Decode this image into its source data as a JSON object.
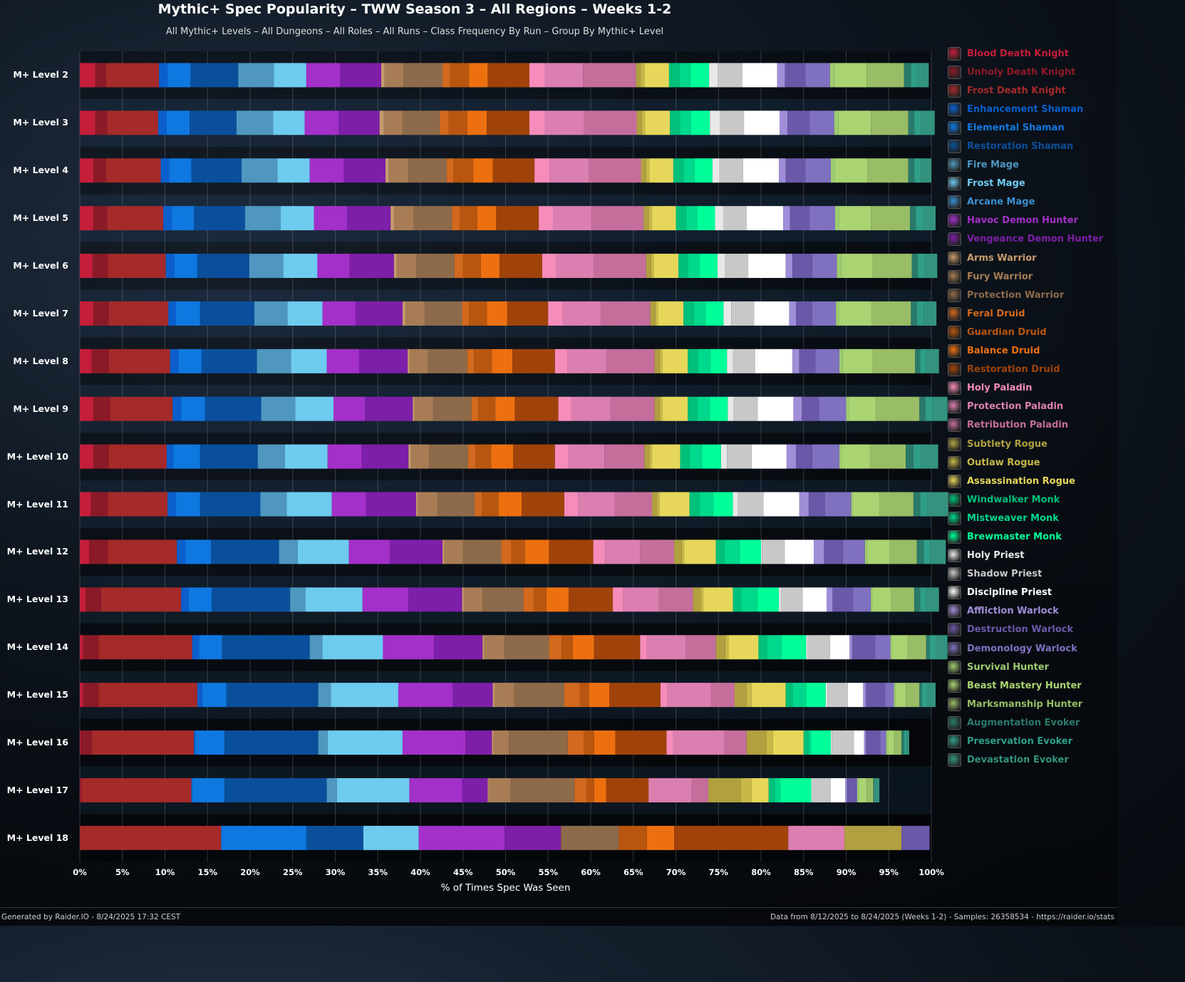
{
  "chart_data": {
    "type": "bar",
    "stacked": true,
    "orientation": "horizontal",
    "title": "Mythic+ Spec Popularity – TWW Season 3 – All Regions – Weeks 1-2",
    "subtitle": "All Mythic+ Levels – All Dungeons – All Roles – All Runs – Class Frequency By Run – Group By Mythic+ Level",
    "xlabel": "% of Times Spec Was Seen",
    "xlim": [
      0,
      100
    ],
    "xticks": [
      "0%",
      "5%",
      "10%",
      "15%",
      "20%",
      "25%",
      "30%",
      "35%",
      "40%",
      "45%",
      "50%",
      "55%",
      "60%",
      "65%",
      "70%",
      "75%",
      "80%",
      "85%",
      "90%",
      "95%",
      "100%"
    ],
    "grid": true,
    "legend_position": "right",
    "categories": [
      "M+ Level 2",
      "M+ Level 3",
      "M+ Level 4",
      "M+ Level 5",
      "M+ Level 6",
      "M+ Level 7",
      "M+ Level 8",
      "M+ Level 9",
      "M+ Level 10",
      "M+ Level 11",
      "M+ Level 12",
      "M+ Level 13",
      "M+ Level 14",
      "M+ Level 15",
      "M+ Level 16",
      "M+ Level 17",
      "M+ Level 18"
    ],
    "series": [
      {
        "name": "Blood Death Knight",
        "color": "#c41e3a",
        "values": [
          1.8,
          1.8,
          1.6,
          1.6,
          1.5,
          1.6,
          1.4,
          1.6,
          1.6,
          1.3,
          1.1,
          0.7,
          0.4,
          0.4,
          0.1,
          0.1,
          0
        ]
      },
      {
        "name": "Unholy Death Knight",
        "color": "#8b1a28",
        "values": [
          1.3,
          1.4,
          1.5,
          1.6,
          1.8,
          1.8,
          2.0,
          2.0,
          1.8,
          2.0,
          2.2,
          1.8,
          1.8,
          1.8,
          1.3,
          0.1,
          0
        ]
      },
      {
        "name": "Frost Death Knight",
        "color": "#a52a2a",
        "values": [
          6.2,
          6.0,
          6.4,
          6.6,
          6.8,
          7.0,
          7.2,
          7.3,
          6.8,
          7.0,
          8.1,
          9.4,
          11.0,
          11.6,
          12.0,
          12.9,
          16.6
        ]
      },
      {
        "name": "Enhancement Shaman",
        "color": "#0a5fcc",
        "values": [
          1.0,
          1.0,
          1.0,
          1.0,
          1.0,
          0.9,
          1.0,
          1.0,
          0.8,
          1.0,
          1.0,
          0.9,
          0.8,
          0.6,
          0.2,
          0.1,
          0
        ]
      },
      {
        "name": "Elemental Shaman",
        "color": "#0f78e0",
        "values": [
          2.7,
          2.7,
          2.6,
          2.6,
          2.7,
          2.8,
          2.7,
          2.8,
          3.1,
          2.8,
          3.0,
          2.7,
          2.7,
          2.8,
          3.4,
          3.8,
          10.0
        ]
      },
      {
        "name": "Restoration Shaman",
        "color": "#0a4f9c",
        "values": [
          5.6,
          5.5,
          5.9,
          6.0,
          6.1,
          6.4,
          6.5,
          6.6,
          6.8,
          7.1,
          8.0,
          9.2,
          10.3,
          10.8,
          11.0,
          12.0,
          6.7
        ]
      },
      {
        "name": "Fire Mage",
        "color": "#4f97bf",
        "values": [
          4.2,
          4.3,
          4.2,
          4.2,
          4.0,
          3.9,
          4.0,
          4.0,
          3.2,
          3.1,
          2.2,
          1.8,
          1.5,
          1.5,
          1.1,
          1.2,
          0
        ]
      },
      {
        "name": "Frost Mage",
        "color": "#6ecbf0",
        "values": [
          3.8,
          3.7,
          3.8,
          3.9,
          4.0,
          4.1,
          4.2,
          4.5,
          5.0,
          5.3,
          6.0,
          6.7,
          7.1,
          7.9,
          8.8,
          8.5,
          6.5
        ]
      },
      {
        "name": "Arcane Mage",
        "color": "#3a8fd0",
        "values": [
          0,
          0,
          0,
          0,
          0,
          0,
          0,
          0,
          0,
          0,
          0,
          0,
          0,
          0,
          0,
          0,
          0
        ]
      },
      {
        "name": "Havoc Demon Hunter",
        "color": "#a330c9",
        "values": [
          4.0,
          4.0,
          4.0,
          3.9,
          3.8,
          3.9,
          3.8,
          3.7,
          4.0,
          4.0,
          4.8,
          5.4,
          6.0,
          6.4,
          7.4,
          6.2,
          10.1
        ]
      },
      {
        "name": "Vengeance Demon Hunter",
        "color": "#7d1fa8",
        "values": [
          4.8,
          4.8,
          4.9,
          5.1,
          5.2,
          5.5,
          5.7,
          5.6,
          5.5,
          5.9,
          6.2,
          6.3,
          5.7,
          4.7,
          3.1,
          3.0,
          6.6
        ]
      },
      {
        "name": "Arms Warrior",
        "color": "#c69b6d",
        "values": [
          0.4,
          0.5,
          0.4,
          0.4,
          0.3,
          0.3,
          0.2,
          0.2,
          0.3,
          0.2,
          0.2,
          0.2,
          0.2,
          0.2,
          0.2,
          0.1,
          0
        ]
      },
      {
        "name": "Fury Warrior",
        "color": "#a87d55",
        "values": [
          2.2,
          2.2,
          2.3,
          2.3,
          2.3,
          2.3,
          2.2,
          2.2,
          2.1,
          2.3,
          2.2,
          2.2,
          2.4,
          2.3,
          1.8,
          2.6,
          0
        ]
      },
      {
        "name": "Protection Warrior",
        "color": "#8d6a4a",
        "values": [
          4.6,
          4.4,
          4.5,
          4.5,
          4.5,
          4.4,
          4.6,
          4.5,
          4.6,
          4.4,
          4.5,
          4.8,
          5.2,
          5.9,
          6.9,
          7.5,
          6.8
        ]
      },
      {
        "name": "Feral Druid",
        "color": "#d2691e",
        "values": [
          0.9,
          1.0,
          0.8,
          0.9,
          1.0,
          0.8,
          0.8,
          0.8,
          0.9,
          0.8,
          1.2,
          1.2,
          1.5,
          1.8,
          1.9,
          1.4,
          0
        ]
      },
      {
        "name": "Guardian Druid",
        "color": "#b8560f",
        "values": [
          2.2,
          2.2,
          2.3,
          2.1,
          2.1,
          2.1,
          2.1,
          2.0,
          1.8,
          2.0,
          1.6,
          1.5,
          1.3,
          1.1,
          1.2,
          0.9,
          3.3
        ]
      },
      {
        "name": "Balance Druid",
        "color": "#ed7010",
        "values": [
          2.2,
          2.3,
          2.3,
          2.2,
          2.2,
          2.4,
          2.4,
          2.3,
          2.6,
          2.7,
          2.8,
          2.6,
          2.5,
          2.4,
          2.5,
          1.4,
          3.2
        ]
      },
      {
        "name": "Restoration Druid",
        "color": "#a0430a",
        "values": [
          4.9,
          5.0,
          4.9,
          5.0,
          5.0,
          4.8,
          5.0,
          5.1,
          4.9,
          5.0,
          5.2,
          5.2,
          5.4,
          6.0,
          6.0,
          5.0,
          13.4
        ]
      },
      {
        "name": "Holy Paladin",
        "color": "#f58cba",
        "values": [
          1.8,
          1.8,
          1.8,
          1.7,
          1.6,
          1.7,
          1.5,
          1.5,
          1.6,
          1.6,
          1.4,
          1.2,
          0.8,
          0.8,
          0.8,
          0.1,
          0
        ]
      },
      {
        "name": "Protection Paladin",
        "color": "#db7fb0",
        "values": [
          4.5,
          4.6,
          4.6,
          4.5,
          4.5,
          4.5,
          4.6,
          4.6,
          4.2,
          4.3,
          4.1,
          4.2,
          4.6,
          5.1,
          6.0,
          4.9,
          6.6
        ]
      },
      {
        "name": "Retribution Paladin",
        "color": "#c56e9c",
        "values": [
          6.2,
          6.2,
          6.1,
          6.1,
          6.1,
          5.8,
          5.6,
          5.2,
          4.7,
          4.4,
          4.0,
          4.0,
          3.5,
          2.8,
          2.6,
          2.0,
          0
        ]
      },
      {
        "name": "Subtlety Rogue",
        "color": "#b0a040",
        "values": [
          0.6,
          0.6,
          0.6,
          0.6,
          0.6,
          0.6,
          0.6,
          0.6,
          0.6,
          0.6,
          0.9,
          0.9,
          1.1,
          1.4,
          2.3,
          3.8,
          6.7
        ]
      },
      {
        "name": "Outlaw Rogue",
        "color": "#c8b848",
        "values": [
          0.4,
          0.4,
          0.4,
          0.4,
          0.3,
          0.3,
          0.3,
          0.3,
          0.3,
          0.3,
          0.3,
          0.3,
          0.4,
          0.6,
          0.8,
          1.3,
          0
        ]
      },
      {
        "name": "Assassination Rogue",
        "color": "#e6d75a",
        "values": [
          2.9,
          2.9,
          2.8,
          2.8,
          2.9,
          3.0,
          3.0,
          3.0,
          3.3,
          3.5,
          3.7,
          3.5,
          3.5,
          4.0,
          3.6,
          2.0,
          0
        ]
      },
      {
        "name": "Windwalker Monk",
        "color": "#00c07a",
        "values": [
          1.2,
          1.2,
          1.2,
          1.2,
          1.1,
          1.2,
          1.2,
          1.1,
          1.1,
          1.2,
          1.0,
          1.0,
          1.0,
          0.8,
          0.6,
          0.7,
          0
        ]
      },
      {
        "name": "Mistweaver Monk",
        "color": "#00d88c",
        "values": [
          1.3,
          1.3,
          1.3,
          1.3,
          1.4,
          1.4,
          1.5,
          1.5,
          1.5,
          1.6,
          1.8,
          1.9,
          1.7,
          1.6,
          0.3,
          0.7,
          0
        ]
      },
      {
        "name": "Brewmaster Monk",
        "color": "#00ff98",
        "values": [
          2.2,
          2.2,
          2.1,
          2.1,
          2.1,
          2.1,
          1.9,
          2.1,
          2.2,
          2.3,
          2.5,
          2.5,
          2.9,
          2.3,
          2.3,
          3.6,
          0
        ]
      },
      {
        "name": "Holy Priest",
        "color": "#e8e8e8",
        "values": [
          1.0,
          1.2,
          0.8,
          1.0,
          0.9,
          0.9,
          0.7,
          0.7,
          0.7,
          0.6,
          0.1,
          0.2,
          0.2,
          0.2,
          0.1,
          0.1,
          0
        ]
      },
      {
        "name": "Shadow Priest",
        "color": "#c8c8c8",
        "values": [
          2.9,
          2.8,
          2.8,
          2.7,
          2.7,
          2.7,
          2.6,
          2.8,
          2.9,
          3.0,
          2.7,
          2.6,
          2.6,
          2.4,
          2.6,
          2.2,
          0
        ]
      },
      {
        "name": "Discipline Priest",
        "color": "#ffffff",
        "values": [
          4.1,
          4.2,
          4.2,
          4.3,
          4.4,
          4.1,
          4.4,
          4.2,
          4.1,
          4.2,
          3.4,
          2.8,
          2.3,
          1.8,
          1.2,
          1.7,
          0
        ]
      },
      {
        "name": "Affliction Warlock",
        "color": "#a08ed8",
        "values": [
          0.9,
          0.9,
          0.8,
          0.8,
          0.8,
          0.8,
          0.8,
          1.0,
          1.1,
          1.1,
          1.2,
          0.7,
          0.3,
          0.3,
          0.2,
          0.2,
          0
        ]
      },
      {
        "name": "Destruction Warlock",
        "color": "#6a58a8",
        "values": [
          2.4,
          2.6,
          2.3,
          2.3,
          2.3,
          1.9,
          1.9,
          2.0,
          1.9,
          1.9,
          2.2,
          2.4,
          2.7,
          2.3,
          1.7,
          1.1,
          3.3
        ]
      },
      {
        "name": "Demonology Warlock",
        "color": "#8070c0",
        "values": [
          2.9,
          2.9,
          3.0,
          3.0,
          2.9,
          2.8,
          2.8,
          3.2,
          3.2,
          3.1,
          2.6,
          2.1,
          1.8,
          1.0,
          0.7,
          0.1,
          0
        ]
      },
      {
        "name": "Survival Hunter",
        "color": "#9ccc70",
        "values": [
          0.5,
          0.5,
          0.5,
          0.5,
          0.5,
          0.4,
          0.4,
          0.3,
          0.3,
          0.2,
          0.2,
          0.2,
          0.2,
          0.2,
          0.2,
          0.1,
          0
        ]
      },
      {
        "name": "Beast Mastery Hunter",
        "color": "#aad372",
        "values": [
          3.8,
          3.8,
          3.8,
          3.7,
          3.7,
          3.8,
          3.5,
          3.2,
          3.3,
          3.1,
          2.7,
          2.2,
          1.8,
          1.2,
          0.7,
          1.0,
          0
        ]
      },
      {
        "name": "Marksmanship Hunter",
        "color": "#98bd66",
        "values": [
          4.4,
          4.4,
          4.8,
          4.6,
          4.6,
          4.6,
          5.0,
          5.1,
          4.2,
          4.0,
          3.2,
          2.7,
          2.2,
          1.6,
          0.9,
          0.8,
          0
        ]
      },
      {
        "name": "Augmentation Evoker",
        "color": "#2a7a6a",
        "values": [
          0.8,
          0.7,
          0.7,
          0.7,
          0.7,
          0.7,
          0.6,
          0.7,
          0.9,
          0.8,
          0.8,
          0.7,
          0.4,
          0.3,
          0.3,
          0.1,
          0
        ]
      },
      {
        "name": "Preservation Evoker",
        "color": "#2f9e88",
        "values": [
          0.8,
          0.8,
          0.8,
          0.8,
          0.8,
          0.8,
          0.7,
          0.8,
          0.8,
          0.8,
          0.8,
          0.7,
          0.7,
          0.6,
          0.3,
          0.1,
          0
        ]
      },
      {
        "name": "Devastation Evoker",
        "color": "#33937f",
        "values": [
          1.3,
          1.6,
          1.2,
          1.5,
          1.5,
          1.5,
          1.5,
          1.8,
          2.1,
          2.5,
          1.8,
          1.5,
          1.4,
          1.0,
          0.3,
          0.5,
          0
        ]
      }
    ]
  },
  "footer": {
    "left": "Generated by Raider.IO - 8/24/2025 17:32 CEST",
    "right": "Data from 8/12/2025 to 8/24/2025 (Weeks 1-2) - Samples: 26358534 - https://raider.io/stats"
  }
}
